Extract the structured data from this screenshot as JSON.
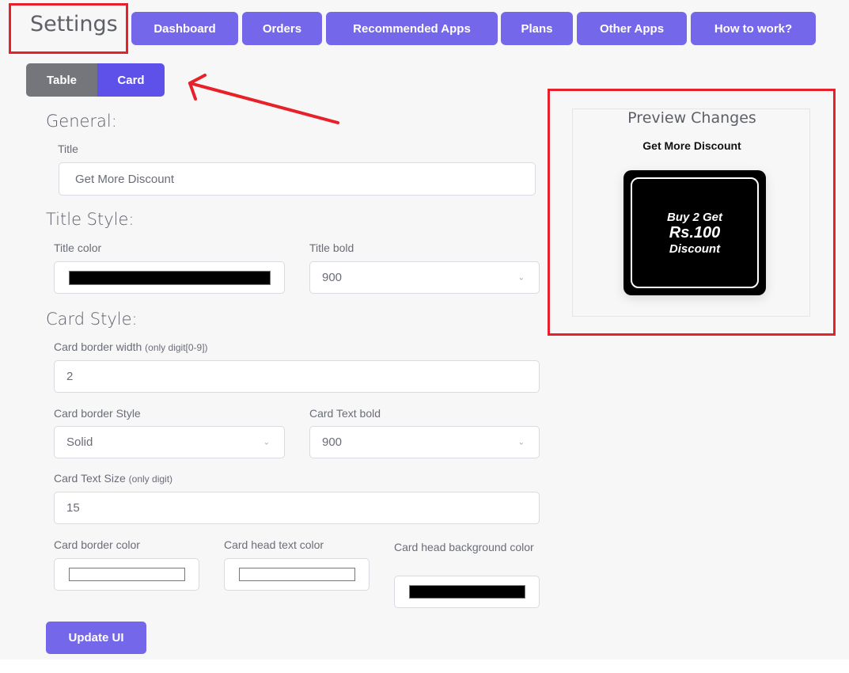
{
  "header": {
    "title": "Settings",
    "nav": [
      {
        "label": "Dashboard"
      },
      {
        "label": "Orders"
      },
      {
        "label": "Recommended Apps"
      },
      {
        "label": "Plans"
      },
      {
        "label": "Other Apps"
      },
      {
        "label": "How to work?"
      }
    ]
  },
  "view_toggle": {
    "options": [
      {
        "label": "Table"
      },
      {
        "label": "Card"
      }
    ],
    "selected": "Card"
  },
  "form": {
    "general": {
      "heading": "General:",
      "title_label": "Title",
      "title_value": "Get More Discount"
    },
    "title_style": {
      "heading": "Title Style:",
      "color_label": "Title color",
      "color_value": "#000000",
      "bold_label": "Title bold",
      "bold_value": "900"
    },
    "card_style": {
      "heading": "Card Style:",
      "border_width_label": "Card border width",
      "border_width_hint": "(only digit[0-9])",
      "border_width_value": "2",
      "border_style_label": "Card border Style",
      "border_style_value": "Solid",
      "text_bold_label": "Card Text bold",
      "text_bold_value": "900",
      "text_size_label": "Card Text Size",
      "text_size_hint": "(only digit)",
      "text_size_value": "15",
      "border_color_label": "Card border color",
      "border_color_value": "#ffffff",
      "head_text_color_label": "Card head text color",
      "head_text_color_value": "#ffffff",
      "head_bg_color_label": "Card head background color",
      "head_bg_color_value": "#000000"
    },
    "update_label": "Update UI"
  },
  "preview": {
    "heading": "Preview Changes",
    "title": "Get More Discount",
    "card_line1": "Buy 2 Get",
    "card_line2": "Rs.100",
    "card_line3": "Discount"
  },
  "colors": {
    "accent": "#7567ea",
    "annotation": "#e8202a"
  }
}
